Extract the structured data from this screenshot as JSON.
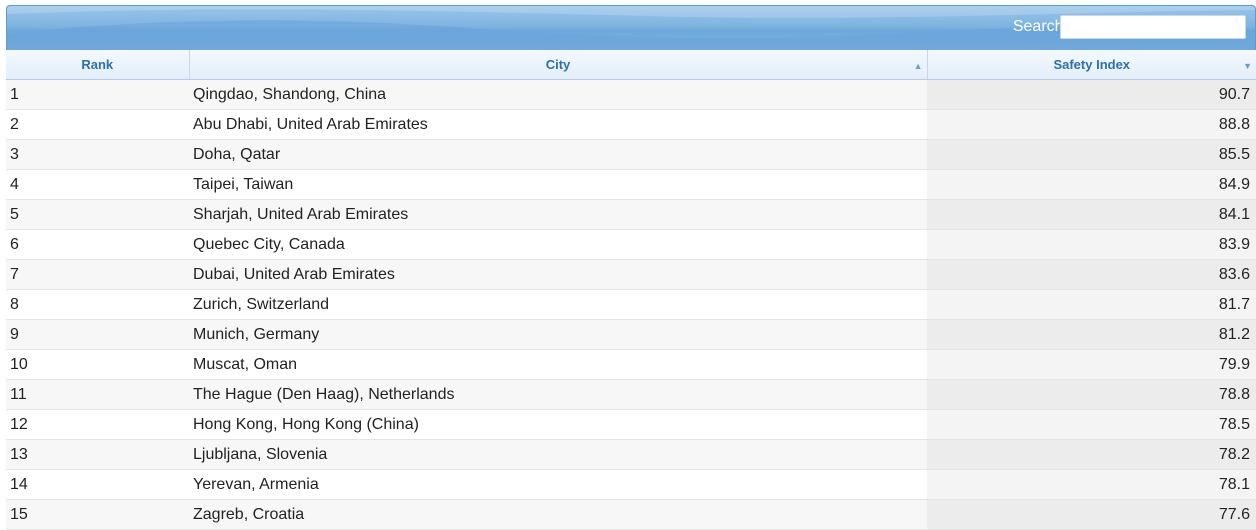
{
  "search": {
    "label": "Search:",
    "value": "",
    "placeholder": ""
  },
  "table": {
    "columns": [
      {
        "key": "rank",
        "label": "Rank",
        "sort": "none"
      },
      {
        "key": "city",
        "label": "City",
        "sort": "ascending"
      },
      {
        "key": "safety_index",
        "label": "Safety Index",
        "sort": "descending"
      }
    ],
    "rows": [
      {
        "rank": "1",
        "city": "Qingdao, Shandong, China",
        "safety_index": "90.7"
      },
      {
        "rank": "2",
        "city": "Abu Dhabi, United Arab Emirates",
        "safety_index": "88.8"
      },
      {
        "rank": "3",
        "city": "Doha, Qatar",
        "safety_index": "85.5"
      },
      {
        "rank": "4",
        "city": "Taipei, Taiwan",
        "safety_index": "84.9"
      },
      {
        "rank": "5",
        "city": "Sharjah, United Arab Emirates",
        "safety_index": "84.1"
      },
      {
        "rank": "6",
        "city": "Quebec City, Canada",
        "safety_index": "83.9"
      },
      {
        "rank": "7",
        "city": "Dubai, United Arab Emirates",
        "safety_index": "83.6"
      },
      {
        "rank": "8",
        "city": "Zurich, Switzerland",
        "safety_index": "81.7"
      },
      {
        "rank": "9",
        "city": "Munich, Germany",
        "safety_index": "81.2"
      },
      {
        "rank": "10",
        "city": "Muscat, Oman",
        "safety_index": "79.9"
      },
      {
        "rank": "11",
        "city": "The Hague (Den Haag), Netherlands",
        "safety_index": "78.8"
      },
      {
        "rank": "12",
        "city": "Hong Kong, Hong Kong (China)",
        "safety_index": "78.5"
      },
      {
        "rank": "13",
        "city": "Ljubljana, Slovenia",
        "safety_index": "78.2"
      },
      {
        "rank": "14",
        "city": "Yerevan, Armenia",
        "safety_index": "78.1"
      },
      {
        "rank": "15",
        "city": "Zagreb, Croatia",
        "safety_index": "77.6"
      }
    ]
  },
  "colors": {
    "header_bar": "#7fb4e1",
    "column_header_text": "#2e6fa7",
    "sorted_column_bg": "#ececec"
  }
}
